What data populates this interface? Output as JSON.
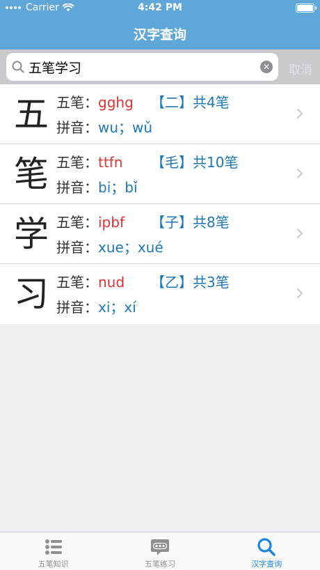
{
  "status": {
    "carrier": "Carrier",
    "time": "4:42 PM"
  },
  "nav": {
    "title": "汉字查询"
  },
  "search": {
    "value": "五笔学习",
    "cancel_label": "取消"
  },
  "results": [
    {
      "char": "五",
      "wubi_label": "五笔：",
      "code": "gghg",
      "strokes": "【二】共4笔",
      "pinyin_label": "拼音：",
      "pinyin": "wu；wǔ"
    },
    {
      "char": "笔",
      "wubi_label": "五笔：",
      "code": "ttfn",
      "strokes": "【毛】共10笔",
      "pinyin_label": "拼音：",
      "pinyin": "bi；bǐ"
    },
    {
      "char": "学",
      "wubi_label": "五笔：",
      "code": "ipbf",
      "strokes": "【子】共8笔",
      "pinyin_label": "拼音：",
      "pinyin": "xue；xué"
    },
    {
      "char": "习",
      "wubi_label": "五笔：",
      "code": "nud",
      "strokes": "【乙】共3笔",
      "pinyin_label": "拼音：",
      "pinyin": "xi；xí"
    }
  ],
  "tabs": [
    {
      "label": "五笔知识",
      "icon": "list-icon"
    },
    {
      "label": "五笔练习",
      "icon": "chat-icon"
    },
    {
      "label": "汉字查询",
      "icon": "search-icon",
      "active": true
    }
  ],
  "colors": {
    "nav": "#5fa7d8",
    "code": "#dd3333",
    "accent": "#1f77b4",
    "tab_active": "#1a86e0"
  }
}
